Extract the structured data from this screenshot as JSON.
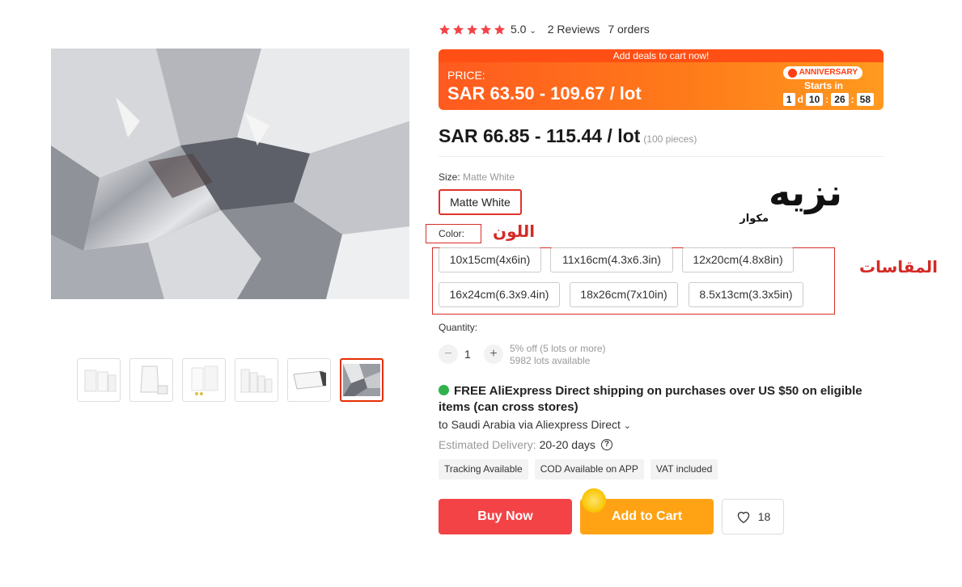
{
  "rating": {
    "score": "5.0",
    "reviews": "2 Reviews",
    "orders": "7 orders"
  },
  "promo": {
    "banner": "Add deals to cart now!",
    "price_label": "PRICE:",
    "price": "SAR 63.50 - 109.67 / lot",
    "event": "ANNIVERSARY",
    "starts_in": "Starts in",
    "countdown": {
      "days": "1",
      "d_label": "d",
      "hours": "10",
      "minutes": "26",
      "seconds": "58"
    }
  },
  "price": {
    "range": "SAR 66.85 - 115.44 / lot",
    "pieces": "(100 pieces)"
  },
  "size": {
    "label": "Size:",
    "value": "Matte White",
    "option": "Matte White"
  },
  "color": {
    "label": "Color:"
  },
  "annotations": {
    "color": "اللون",
    "sizes": "المقاسات"
  },
  "logo": {
    "main": "نزيه",
    "sub": "مكوار"
  },
  "options": [
    "10x15cm(4x6in)",
    "11x16cm(4.3x6.3in)",
    "12x20cm(4.8x8in)",
    "16x24cm(6.3x9.4in)",
    "18x26cm(7x10in)",
    "8.5x13cm(3.3x5in)"
  ],
  "quantity": {
    "label": "Quantity:",
    "value": "1",
    "minus": "−",
    "plus": "+",
    "discount": "5% off (5 lots or more)",
    "available": "5982 lots available"
  },
  "shipping": {
    "headline": "FREE AliExpress Direct shipping on purchases over US $50 on eligible items (can cross stores)",
    "to": "to Saudi Arabia via Aliexpress Direct",
    "eta_label": "Estimated Delivery:",
    "eta_value": "20-20 days",
    "help": "?"
  },
  "tags": [
    "Tracking Available",
    "COD Available on APP",
    "VAT included"
  ],
  "actions": {
    "buy": "Buy Now",
    "cart": "Add to Cart",
    "wishlist_count": "18"
  },
  "colors": {
    "accent": "#f44347",
    "cart": "#ffa315",
    "promo": "#ff7a1a",
    "annotation": "#d42a26"
  }
}
